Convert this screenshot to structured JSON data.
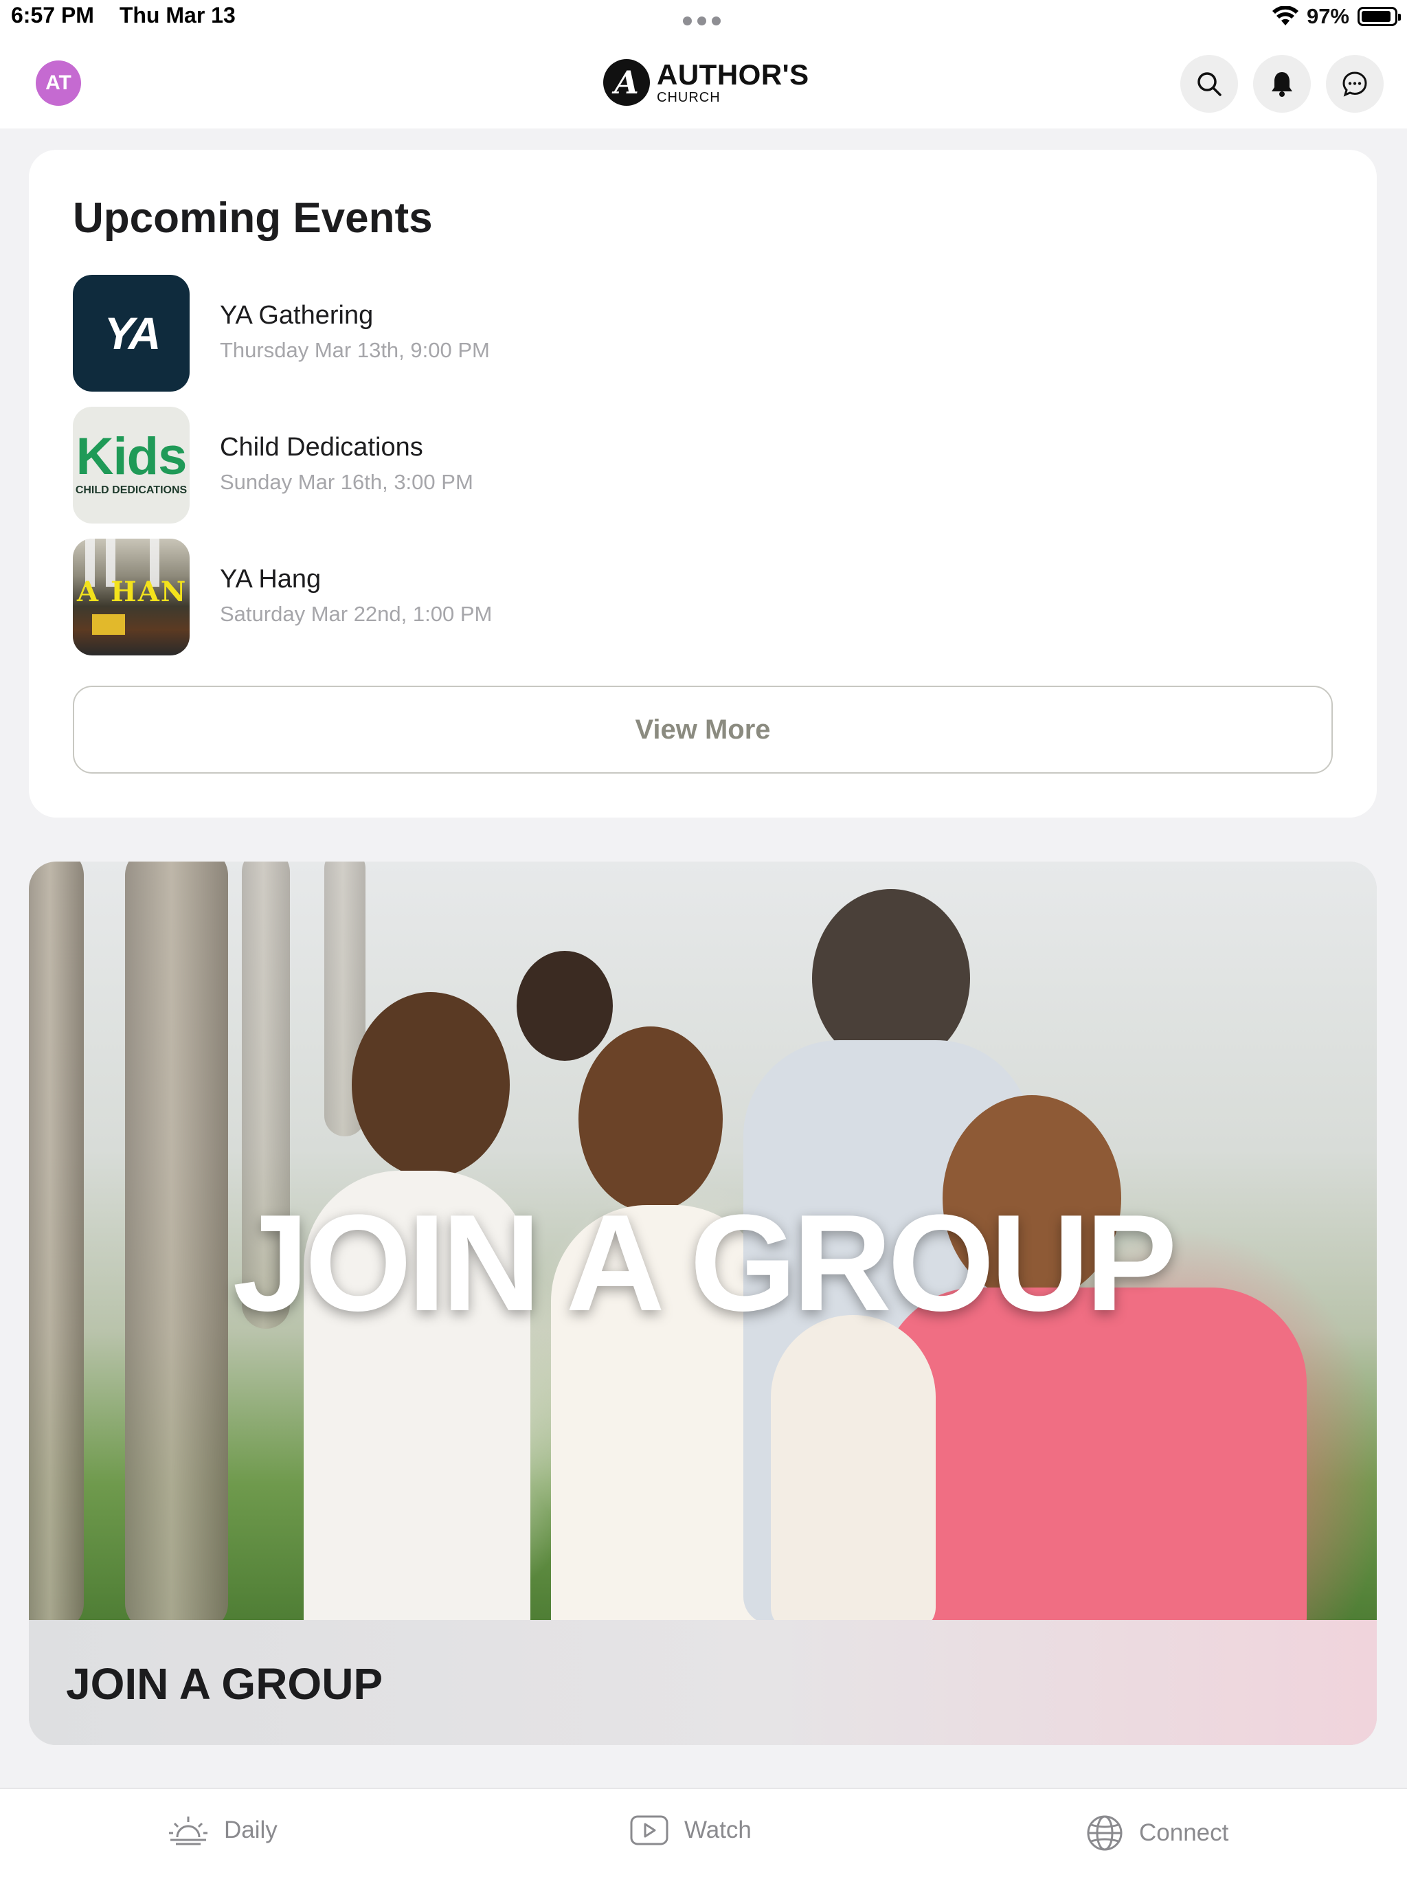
{
  "status_bar": {
    "time": "6:57 PM",
    "date": "Thu Mar 13",
    "battery": "97%",
    "battery_level": 0.97
  },
  "header": {
    "avatar_initials": "AT",
    "logo_mark": "A",
    "logo_title": "AUTHOR'S",
    "logo_subtitle": "CHURCH",
    "buttons": [
      "search-icon",
      "bell-icon",
      "chat-icon"
    ]
  },
  "events": {
    "title": "Upcoming Events",
    "items": [
      {
        "name": "YA Gathering",
        "date": "Thursday Mar 13th, 9:00 PM",
        "thumb_text": "YA"
      },
      {
        "name": "Child Dedications",
        "date": "Sunday Mar 16th, 3:00 PM",
        "thumb_text": "Kids",
        "thumb_subtext": "CHILD DEDICATIONS"
      },
      {
        "name": "YA Hang",
        "date": "Saturday Mar 22nd, 1:00 PM",
        "thumb_text": "A HAN"
      }
    ],
    "view_more_label": "View More"
  },
  "group_card": {
    "overlay_text": "JOIN A GROUP",
    "label": "JOIN A GROUP"
  },
  "tab_bar": {
    "tabs": [
      {
        "label": "Daily",
        "icon": "sunrise-icon"
      },
      {
        "label": "Watch",
        "icon": "play-icon"
      },
      {
        "label": "Connect",
        "icon": "globe-icon"
      }
    ]
  },
  "colors": {
    "avatar": "#c56ad1",
    "kids_green": "#1f9a57",
    "ya_navy": "#0f2b3d",
    "tab_gray": "#8a8a8e"
  }
}
